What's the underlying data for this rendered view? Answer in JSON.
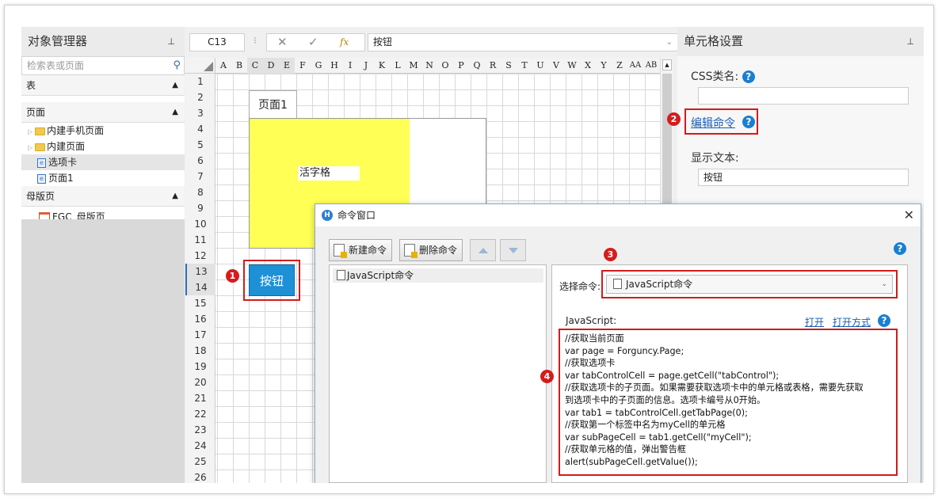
{
  "left_panel": {
    "title": "对象管理器",
    "pin": "⊥",
    "search_placeholder": "检索表或页面",
    "sections": {
      "tables": "表",
      "pages": "页面",
      "master": "母版页"
    },
    "page_items": [
      "内建手机页面",
      "内建页面",
      "选项卡",
      "页面1"
    ],
    "master_items": [
      "FGC_母版页"
    ]
  },
  "formula_bar": {
    "cell_ref": "C13",
    "dots": "⁝",
    "cancel": "✕",
    "confirm": "✓",
    "fx": "fx",
    "value": "按钮"
  },
  "grid": {
    "columns": [
      "A",
      "B",
      "C",
      "D",
      "E",
      "F",
      "G",
      "H",
      "I",
      "J",
      "K",
      "L",
      "M",
      "N",
      "O",
      "P",
      "Q",
      "R",
      "S",
      "T",
      "U",
      "V",
      "W",
      "X",
      "Y",
      "Z",
      "AA",
      "AB"
    ],
    "rows": [
      "1",
      "2",
      "3",
      "4",
      "5",
      "6",
      "7",
      "8",
      "9",
      "10",
      "11",
      "12",
      "13",
      "14",
      "15",
      "16",
      "17",
      "18",
      "19",
      "20",
      "21",
      "22",
      "23",
      "24",
      "25",
      "26"
    ],
    "page_tab_label": "页面1",
    "inner_cell_label": "活字格",
    "button_label": "按钮"
  },
  "badges": [
    "1",
    "2",
    "3",
    "4"
  ],
  "right_panel": {
    "title": "单元格设置",
    "css_label": "CSS类名:",
    "css_value": "",
    "edit_command_label": "编辑命令",
    "display_text_label": "显示文本:",
    "display_text_value": "按钮",
    "help_glyph": "?"
  },
  "dialog": {
    "title": "命令窗口",
    "close": "✕",
    "new_command": "新建命令",
    "delete_command": "删除命令",
    "list_items": [
      "JavaScript命令"
    ],
    "select_label": "选择命令:",
    "select_value": "JavaScript命令",
    "js_label": "JavaScript:",
    "open_link": "打开",
    "open_with_link": "打开方式",
    "code": "//获取当前页面\nvar page = Forguncy.Page;\n//获取选项卡\nvar tabControlCell = page.getCell(\"tabControl\");\n//获取选项卡的子页面。如果需要获取选项卡中的单元格或表格，需要先获取\n到选项卡中的子页面的信息。选项卡编号从0开始。\nvar tab1 = tabControlCell.getTabPage(0);\n//获取第一个标签中名为myCell的单元格\nvar subPageCell = tab1.getCell(\"myCell\");\n//获取单元格的值，弹出警告框\nalert(subPageCell.getValue());"
  },
  "colors": {
    "highlight_red": "#d01c1c",
    "button_blue": "#1e90d6",
    "cell_yellow": "#ffff55",
    "link_blue": "#1a5fb4"
  }
}
